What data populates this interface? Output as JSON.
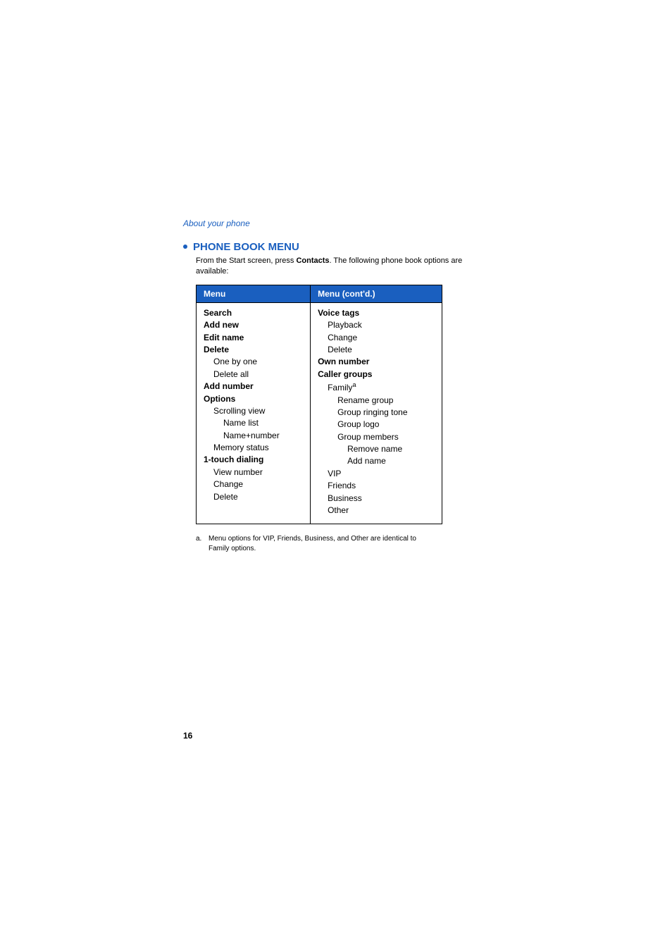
{
  "header": {
    "breadcrumb": "About your phone"
  },
  "section": {
    "heading": "PHONE BOOK MENU",
    "intro_prefix": "From the Start screen, press ",
    "intro_bold": "Contacts",
    "intro_suffix": ". The following phone book options are available:"
  },
  "table": {
    "header_left": "Menu",
    "header_right": "Menu (cont'd.)",
    "left": {
      "search": "Search",
      "add_new": "Add new",
      "edit_name": "Edit name",
      "delete": "Delete",
      "one_by_one": "One by one",
      "delete_all": "Delete all",
      "add_number": "Add number",
      "options": "Options",
      "scrolling_view": "Scrolling view",
      "name_list": "Name list",
      "name_number": "Name+number",
      "memory_status": "Memory status",
      "one_touch": "1-touch dialing",
      "view_number": "View number",
      "change": "Change",
      "delete2": "Delete"
    },
    "right": {
      "voice_tags": "Voice tags",
      "playback": "Playback",
      "change": "Change",
      "delete": "Delete",
      "own_number": "Own number",
      "caller_groups": "Caller groups",
      "family": "Family",
      "family_sup": "a",
      "rename_group": "Rename group",
      "group_ringing": "Group ringing tone",
      "group_logo": "Group logo",
      "group_members": "Group members",
      "remove_name": "Remove name",
      "add_name": "Add name",
      "vip": "VIP",
      "friends": "Friends",
      "business": "Business",
      "other": "Other"
    }
  },
  "footnote": {
    "marker": "a.",
    "text": "Menu options for VIP, Friends, Business, and Other are identical to Family options."
  },
  "page_number": "16"
}
